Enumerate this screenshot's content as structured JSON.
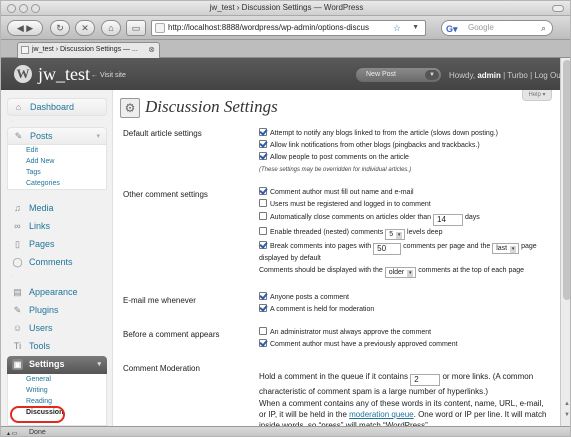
{
  "window": {
    "title": "jw_test › Discussion Settings — WordPress"
  },
  "browser": {
    "url": "http://localhost:8888/wordpress/wp-admin/options-discus",
    "search_placeholder": "Google",
    "tab_title": "jw_test › Discussion Settings — ...",
    "status": "Done"
  },
  "wp_header": {
    "site_name": "jw_test",
    "visit_site": "← Visit site",
    "new_post": "New Post",
    "howdy_prefix": "Howdy,",
    "user": "admin",
    "links": "| Turbo | Log Out"
  },
  "sidebar": {
    "dashboard": "Dashboard",
    "posts": "Posts",
    "posts_sub": [
      "Edit",
      "Add New",
      "Tags",
      "Categories"
    ],
    "media": "Media",
    "links": "Links",
    "pages": "Pages",
    "comments": "Comments",
    "appearance": "Appearance",
    "plugins": "Plugins",
    "users": "Users",
    "tools": "Tools",
    "settings": "Settings",
    "settings_sub": [
      "General",
      "Writing",
      "Reading",
      "Discussion"
    ]
  },
  "main": {
    "help": "Help ▾",
    "page_title": "Discussion Settings",
    "sections": {
      "default_article": "Default article settings",
      "other_comment": "Other comment settings",
      "email_me": "E-mail me whenever",
      "before_appears": "Before a comment appears",
      "moderation": "Comment Moderation"
    },
    "default_opts": [
      "Attempt to notify any blogs linked to from the article (slows down posting.)",
      "Allow link notifications from other blogs (pingbacks and trackbacks.)",
      "Allow people to post comments on the article"
    ],
    "default_note": "(These settings may be overridden for individual articles.)",
    "other_opts": {
      "name_email": "Comment author must fill out name and e-mail",
      "registered": "Users must be registered and logged in to comment",
      "auto_close_pre": "Automatically close comments on articles older than",
      "auto_close_val": "14",
      "auto_close_post": "days",
      "threaded_pre": "Enable threaded (nested) comments",
      "threaded_val": "5",
      "threaded_post": "levels deep",
      "break_pre": "Break comments into pages with",
      "break_val": "50",
      "break_mid": "comments per page and the",
      "break_sel": "last",
      "break_post": "page",
      "break_cont": "displayed by default",
      "order_pre": "Comments should be displayed with the",
      "order_sel": "older",
      "order_post": "comments at the top of each page"
    },
    "email_opts": [
      "Anyone posts a comment",
      "A comment is held for moderation"
    ],
    "before_opts": [
      "An administrator must always approve the comment",
      "Comment author must have a previously approved comment"
    ],
    "moderation": {
      "hold_pre": "Hold a comment in the queue if it contains",
      "hold_val": "2",
      "hold_post": "or more links. (A common characteristic of comment spam is a large number of hyperlinks.)",
      "p2_pre": "When a comment contains any of these words in its content, name, URL, e-mail, or IP, it will be held in the",
      "p2_link": "moderation queue",
      "p2_post": ". One word or IP per line. It will match inside words, so “press” will match “WordPress”."
    }
  },
  "colors": {
    "highlight": "#e02a1e",
    "link": "#21759b",
    "header": "#464646"
  }
}
